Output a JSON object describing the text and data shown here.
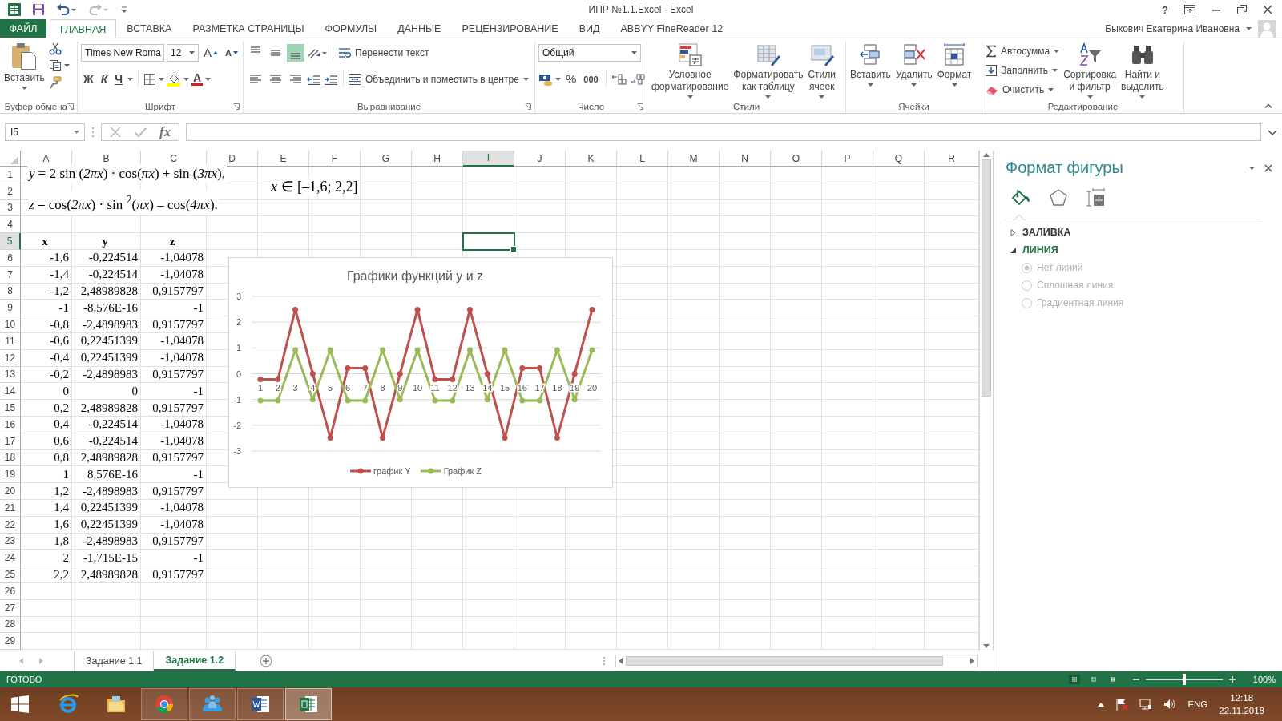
{
  "title_bar": {
    "title": "ИПР №1.1.Excel - Excel",
    "help": "?",
    "quick_access": [
      {
        "disabled": false
      },
      {
        "disabled": false
      },
      {
        "disabled": true
      },
      {
        "disabled": false
      }
    ]
  },
  "ribbon_tabs": [
    {
      "label": "ФАЙЛ",
      "kind": "file",
      "selected": false
    },
    {
      "label": "ГЛАВНАЯ",
      "kind": "tab",
      "selected": true
    },
    {
      "label": "ВСТАВКА",
      "kind": "tab",
      "selected": false
    },
    {
      "label": "РАЗМЕТКА СТРАНИЦЫ",
      "kind": "tab",
      "selected": false
    },
    {
      "label": "ФОРМУЛЫ",
      "kind": "tab",
      "selected": false
    },
    {
      "label": "ДАННЫЕ",
      "kind": "tab",
      "selected": false
    },
    {
      "label": "РЕЦЕНЗИРОВАНИЕ",
      "kind": "tab",
      "selected": false
    },
    {
      "label": "ВИД",
      "kind": "tab",
      "selected": false
    },
    {
      "label": "ABBYY FineReader 12",
      "kind": "tab",
      "selected": false
    }
  ],
  "user": {
    "name": "Быкович Екатерина Ивановна"
  },
  "ribbon": {
    "clipboard": {
      "paste": "Вставить",
      "label": "Буфер обмена"
    },
    "font": {
      "font_name": "Times New Roma",
      "font_size": "12",
      "grow": "A",
      "shrink": "A",
      "bold": "Ж",
      "italic": "К",
      "underline": "Ч",
      "font_color": "A",
      "label": "Шрифт"
    },
    "alignment": {
      "bottom_align_selected": true,
      "wrap_text": "Перенести текст",
      "merge": "Объединить и поместить в центре",
      "label": "Выравнивание"
    },
    "number": {
      "format": "Общий",
      "percent": "%",
      "thousands": "000",
      "label": "Число"
    },
    "styles": {
      "conditional": "Условное\nформатирование",
      "as_table": "Форматировать\nкак таблицу",
      "cell_styles": "Стили\nячеек",
      "label": "Стили"
    },
    "cells": {
      "insert": "Вставить",
      "delete": "Удалить",
      "format": "Формат",
      "label": "Ячейки"
    },
    "editing": {
      "autosum": "Автосумма",
      "fill": "Заполнить",
      "clear": "Очистить",
      "sort": "Сортировка\nи фильтр",
      "find": "Найти и\nвыделить",
      "label": "Редактирование"
    }
  },
  "formula_bar": {
    "name_box": "I5",
    "function_label": "fx"
  },
  "sheet": {
    "columns": [
      {
        "label": "A",
        "selected": false
      },
      {
        "label": "B",
        "selected": false
      },
      {
        "label": "C",
        "selected": false
      },
      {
        "label": "D",
        "selected": false
      },
      {
        "label": "E",
        "selected": false
      },
      {
        "label": "F",
        "selected": false
      },
      {
        "label": "G",
        "selected": false
      },
      {
        "label": "H",
        "selected": false
      },
      {
        "label": "I",
        "selected": true
      },
      {
        "label": "J",
        "selected": false
      },
      {
        "label": "K",
        "selected": false
      },
      {
        "label": "L",
        "selected": false
      },
      {
        "label": "M",
        "selected": false
      },
      {
        "label": "N",
        "selected": false
      },
      {
        "label": "O",
        "selected": false
      },
      {
        "label": "P",
        "selected": false
      },
      {
        "label": "Q",
        "selected": false
      },
      {
        "label": "R",
        "selected": false
      }
    ],
    "rows": [
      {
        "label": "1",
        "selected": false
      },
      {
        "label": "2",
        "selected": false
      },
      {
        "label": "3",
        "selected": false
      },
      {
        "label": "4",
        "selected": false
      },
      {
        "label": "5",
        "selected": true
      },
      {
        "label": "6",
        "selected": false
      },
      {
        "label": "7",
        "selected": false
      },
      {
        "label": "8",
        "selected": false
      },
      {
        "label": "9",
        "selected": false
      },
      {
        "label": "10",
        "selected": false
      },
      {
        "label": "11",
        "selected": false
      },
      {
        "label": "12",
        "selected": false
      },
      {
        "label": "13",
        "selected": false
      },
      {
        "label": "14",
        "selected": false
      },
      {
        "label": "15",
        "selected": false
      },
      {
        "label": "16",
        "selected": false
      },
      {
        "label": "17",
        "selected": false
      },
      {
        "label": "18",
        "selected": false
      },
      {
        "label": "19",
        "selected": false
      },
      {
        "label": "20",
        "selected": false
      },
      {
        "label": "21",
        "selected": false
      },
      {
        "label": "22",
        "selected": false
      },
      {
        "label": "23",
        "selected": false
      },
      {
        "label": "24",
        "selected": false
      },
      {
        "label": "25",
        "selected": false
      },
      {
        "label": "26",
        "selected": false
      },
      {
        "label": "27",
        "selected": false
      },
      {
        "label": "28",
        "selected": false
      },
      {
        "label": "29",
        "selected": false
      }
    ],
    "equations": [
      "*y* = 2 sin (*2πx*) · cos(*πx*) + sin (*3πx*),",
      "*z* = cos(*2πx*) · sin $^{2}$(*πx*) – cos(*4πx*)."
    ],
    "interval": "*x* ∈ [–1,6; 2,2]",
    "table": {
      "header": [
        "x",
        "y",
        "z"
      ],
      "rows": [
        [
          "-1,6",
          "-0,224514",
          "-1,04078"
        ],
        [
          "-1,4",
          "-0,224514",
          "-1,04078"
        ],
        [
          "-1,2",
          "2,48989828",
          "0,9157797"
        ],
        [
          "-1",
          "-8,576E-16",
          "-1"
        ],
        [
          "-0,8",
          "-2,4898983",
          "0,9157797"
        ],
        [
          "-0,6",
          "0,22451399",
          "-1,04078"
        ],
        [
          "-0,4",
          "0,22451399",
          "-1,04078"
        ],
        [
          "-0,2",
          "-2,4898983",
          "0,9157797"
        ],
        [
          "0",
          "0",
          "-1"
        ],
        [
          "0,2",
          "2,48989828",
          "0,9157797"
        ],
        [
          "0,4",
          "-0,224514",
          "-1,04078"
        ],
        [
          "0,6",
          "-0,224514",
          "-1,04078"
        ],
        [
          "0,8",
          "2,48989828",
          "0,9157797"
        ],
        [
          "1",
          "8,576E-16",
          "-1"
        ],
        [
          "1,2",
          "-2,4898983",
          "0,9157797"
        ],
        [
          "1,4",
          "0,22451399",
          "-1,04078"
        ],
        [
          "1,6",
          "0,22451399",
          "-1,04078"
        ],
        [
          "1,8",
          "-2,4898983",
          "0,9157797"
        ],
        [
          "2",
          "-1,715E-15",
          "-1"
        ],
        [
          "2,2",
          "2,48989828",
          "0,9157797"
        ]
      ]
    },
    "chart": {
      "chart_data": {
        "type": "line",
        "title": "Графики функций y и z",
        "categories": [
          "1",
          "2",
          "3",
          "4",
          "5",
          "6",
          "7",
          "8",
          "9",
          "10",
          "11",
          "12",
          "13",
          "14",
          "15",
          "16",
          "17",
          "18",
          "19",
          "20"
        ],
        "ylim": [
          -3,
          3
        ],
        "yticks": [
          -3,
          -2,
          -1,
          0,
          1,
          2,
          3
        ],
        "grid": true,
        "legend": true,
        "series": [
          {
            "name": "график Y",
            "color": "#c0504d",
            "marker": true,
            "values": [
              -0.22,
              -0.22,
              2.49,
              0,
              -2.49,
              0.22,
              0.22,
              -2.49,
              0,
              2.49,
              -0.22,
              -0.22,
              2.49,
              0,
              -2.49,
              0.22,
              0.22,
              -2.49,
              0,
              2.49
            ]
          },
          {
            "name": "График Z",
            "color": "#9bbb59",
            "marker": true,
            "values": [
              -1.04,
              -1.04,
              0.92,
              -1,
              0.92,
              -1.04,
              -1.04,
              0.92,
              -1,
              0.92,
              -1.04,
              -1.04,
              0.92,
              -1,
              0.92,
              -1.04,
              -1.04,
              0.92,
              -1,
              0.92
            ]
          }
        ]
      }
    }
  },
  "sheet_tabs": [
    {
      "label": "Задание 1.1",
      "selected": false
    },
    {
      "label": "Задание 1.2",
      "selected": true
    }
  ],
  "format_pane": {
    "title": "Формат фигуры",
    "tabs": [
      {
        "selected": true
      },
      {
        "selected": false
      },
      {
        "selected": false
      }
    ],
    "sections": [
      {
        "label": "ЗАЛИВКА",
        "expanded": false
      },
      {
        "label": "ЛИНИЯ",
        "expanded": true,
        "options": [
          {
            "label": "Нет линий",
            "selected": true,
            "disabled": true
          },
          {
            "label": "Сплошная линия",
            "selected": false,
            "disabled": true
          },
          {
            "label": "Градиентная линия",
            "selected": false,
            "disabled": true
          }
        ]
      }
    ]
  },
  "status_bar": {
    "status": "ГОТОВО",
    "views": [
      {
        "selected": true
      },
      {
        "selected": false
      },
      {
        "selected": false
      }
    ],
    "zoom": {
      "level": 0.5
    },
    "zoom_label": "100%"
  },
  "taskbar": {
    "apps": [
      {
        "kind": "web",
        "running": false,
        "selected": false
      },
      {
        "kind": "files",
        "running": false,
        "selected": false
      },
      {
        "kind": "browser",
        "running": true,
        "selected": false
      },
      {
        "kind": "contacts",
        "running": true,
        "selected": false
      },
      {
        "kind": "writer",
        "running": true,
        "selected": false
      },
      {
        "kind": "sheets",
        "running": true,
        "selected": true
      }
    ],
    "language": "ENG",
    "time": "12:18",
    "date": "22.11.2018"
  }
}
